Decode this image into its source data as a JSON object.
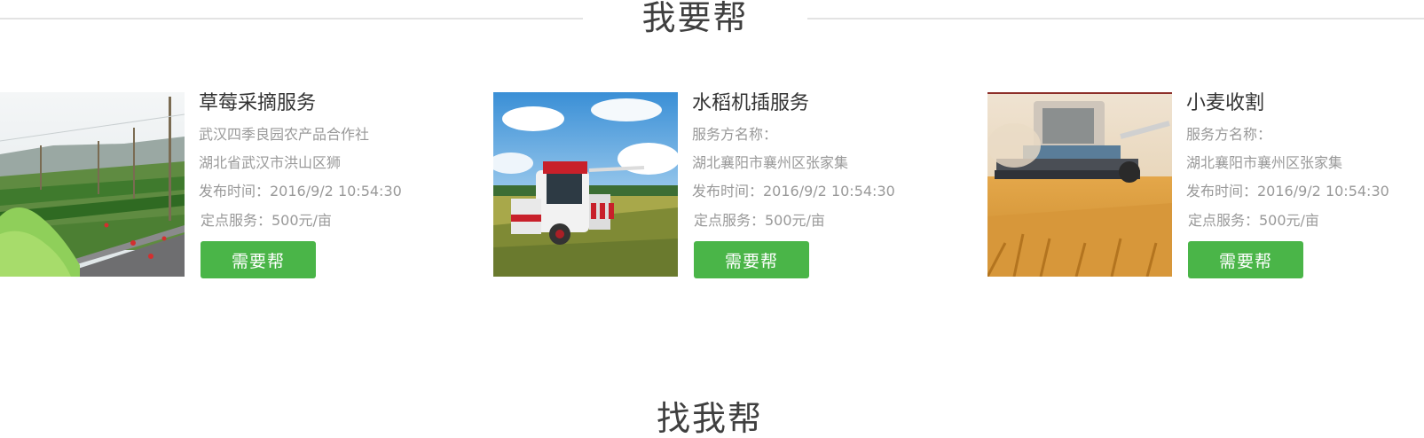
{
  "section": {
    "title": "我要帮",
    "next_title": "找我帮"
  },
  "colors": {
    "accent": "#4ab548",
    "title_text": "#333333",
    "meta_text": "#999999",
    "rule": "#e3e3e3"
  },
  "cards": [
    {
      "image": "strawberry-field-photo",
      "title": "草莓采摘服务",
      "provider": "武汉四季良园农产品合作社",
      "address": "湖北省武汉市洪山区狮",
      "publish_time": "发布时间：2016/9/2 10:54:30",
      "service": "定点服务：500元/亩",
      "button_label": "需要帮"
    },
    {
      "image": "rice-transplanter-photo",
      "title": "水稻机插服务",
      "provider": "服务方名称：",
      "address": "湖北襄阳市襄州区张家集",
      "publish_time": "发布时间：2016/9/2 10:54:30",
      "service": "定点服务：500元/亩",
      "button_label": "需要帮"
    },
    {
      "image": "wheat-harvester-photo",
      "title": "小麦收割",
      "provider": "服务方名称：",
      "address": "湖北襄阳市襄州区张家集",
      "publish_time": "发布时间：2016/9/2 10:54:30",
      "service": "定点服务：500元/亩",
      "button_label": "需要帮"
    }
  ]
}
